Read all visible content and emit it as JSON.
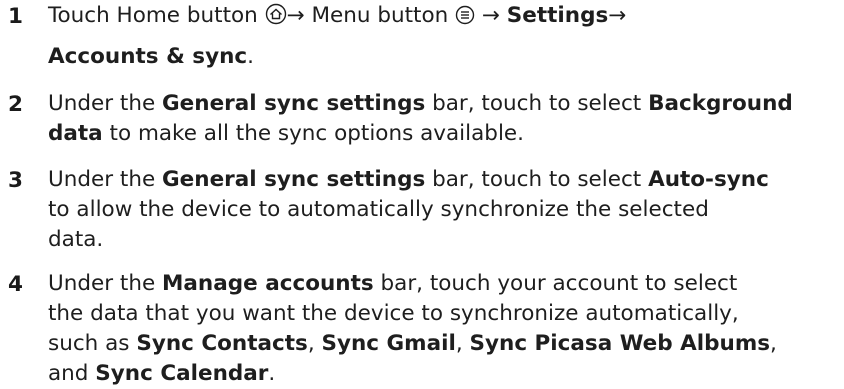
{
  "steps": [
    {
      "number": "1",
      "lines": [
        {
          "parts": [
            {
              "text": "Touch Home button "
            },
            {
              "icon": "home-icon"
            },
            {
              "text": "→ Menu button "
            },
            {
              "icon": "menu-icon"
            },
            {
              "text": " → "
            },
            {
              "text": "Settings",
              "bold": true
            },
            {
              "text": "→"
            }
          ]
        },
        {
          "parts": [
            {
              "text": "Accounts & sync",
              "bold": true
            },
            {
              "text": "."
            }
          ]
        }
      ]
    },
    {
      "number": "2",
      "lines": [
        {
          "parts": [
            {
              "text": "Under the "
            },
            {
              "text": "General sync settings",
              "bold": true
            },
            {
              "text": " bar, touch to select "
            },
            {
              "text": "Background",
              "bold": true
            }
          ]
        },
        {
          "parts": [
            {
              "text": "data",
              "bold": true
            },
            {
              "text": " to make all the sync options available."
            }
          ]
        }
      ]
    },
    {
      "number": "3",
      "lines": [
        {
          "parts": [
            {
              "text": "Under the "
            },
            {
              "text": "General sync settings",
              "bold": true
            },
            {
              "text": " bar, touch to select "
            },
            {
              "text": "Auto-sync",
              "bold": true
            }
          ]
        },
        {
          "parts": [
            {
              "text": "to allow the device to automatically synchronize the selected"
            }
          ]
        },
        {
          "parts": [
            {
              "text": "data."
            }
          ]
        }
      ]
    },
    {
      "number": "4",
      "lines": [
        {
          "parts": [
            {
              "text": "Under the "
            },
            {
              "text": "Manage accounts",
              "bold": true
            },
            {
              "text": " bar, touch your account to select"
            }
          ]
        },
        {
          "parts": [
            {
              "text": "the data that you want the device to synchronize automatically,"
            }
          ]
        },
        {
          "parts": [
            {
              "text": "such as "
            },
            {
              "text": "Sync Contacts",
              "bold": true
            },
            {
              "text": ", "
            },
            {
              "text": "Sync Gmail",
              "bold": true
            },
            {
              "text": ", "
            },
            {
              "text": "Sync Picasa Web Albums",
              "bold": true
            },
            {
              "text": ","
            }
          ]
        },
        {
          "parts": [
            {
              "text": "and "
            },
            {
              "text": "Sync Calendar",
              "bold": true
            },
            {
              "text": "."
            }
          ]
        }
      ]
    }
  ]
}
